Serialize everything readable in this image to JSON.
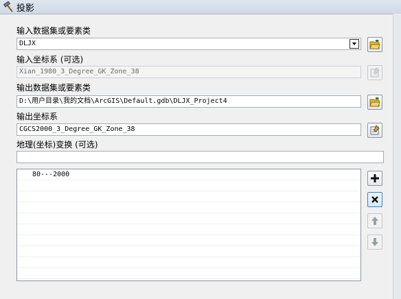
{
  "window": {
    "title": "投影"
  },
  "input_dataset": {
    "label": "输入数据集或要素类",
    "value": "DLJX"
  },
  "input_crs": {
    "label": "输入坐标系 (可选)",
    "value": "Xian_1980_3_Degree_GK_Zone_38"
  },
  "output_dataset": {
    "label": "输出数据集或要素类",
    "value": "D:\\用户目录\\我的文档\\ArcGIS\\Default.gdb\\DLJX_Project4"
  },
  "output_crs": {
    "label": "输出坐标系",
    "value": "CGCS2000_3_Degree_GK_Zone_38"
  },
  "geo_transform": {
    "label": "地理(坐标)变换 (可选)",
    "value": "",
    "items": [
      "80---2000",
      "",
      "",
      "",
      "",
      "",
      "",
      "",
      "",
      ""
    ]
  },
  "icons": {
    "open": "folder-open-icon",
    "properties": "spatial-reference-properties-icon",
    "add": "plus-icon",
    "remove": "x-icon",
    "up": "arrow-up-icon",
    "down": "arrow-down-icon",
    "tool": "hammer-icon"
  }
}
